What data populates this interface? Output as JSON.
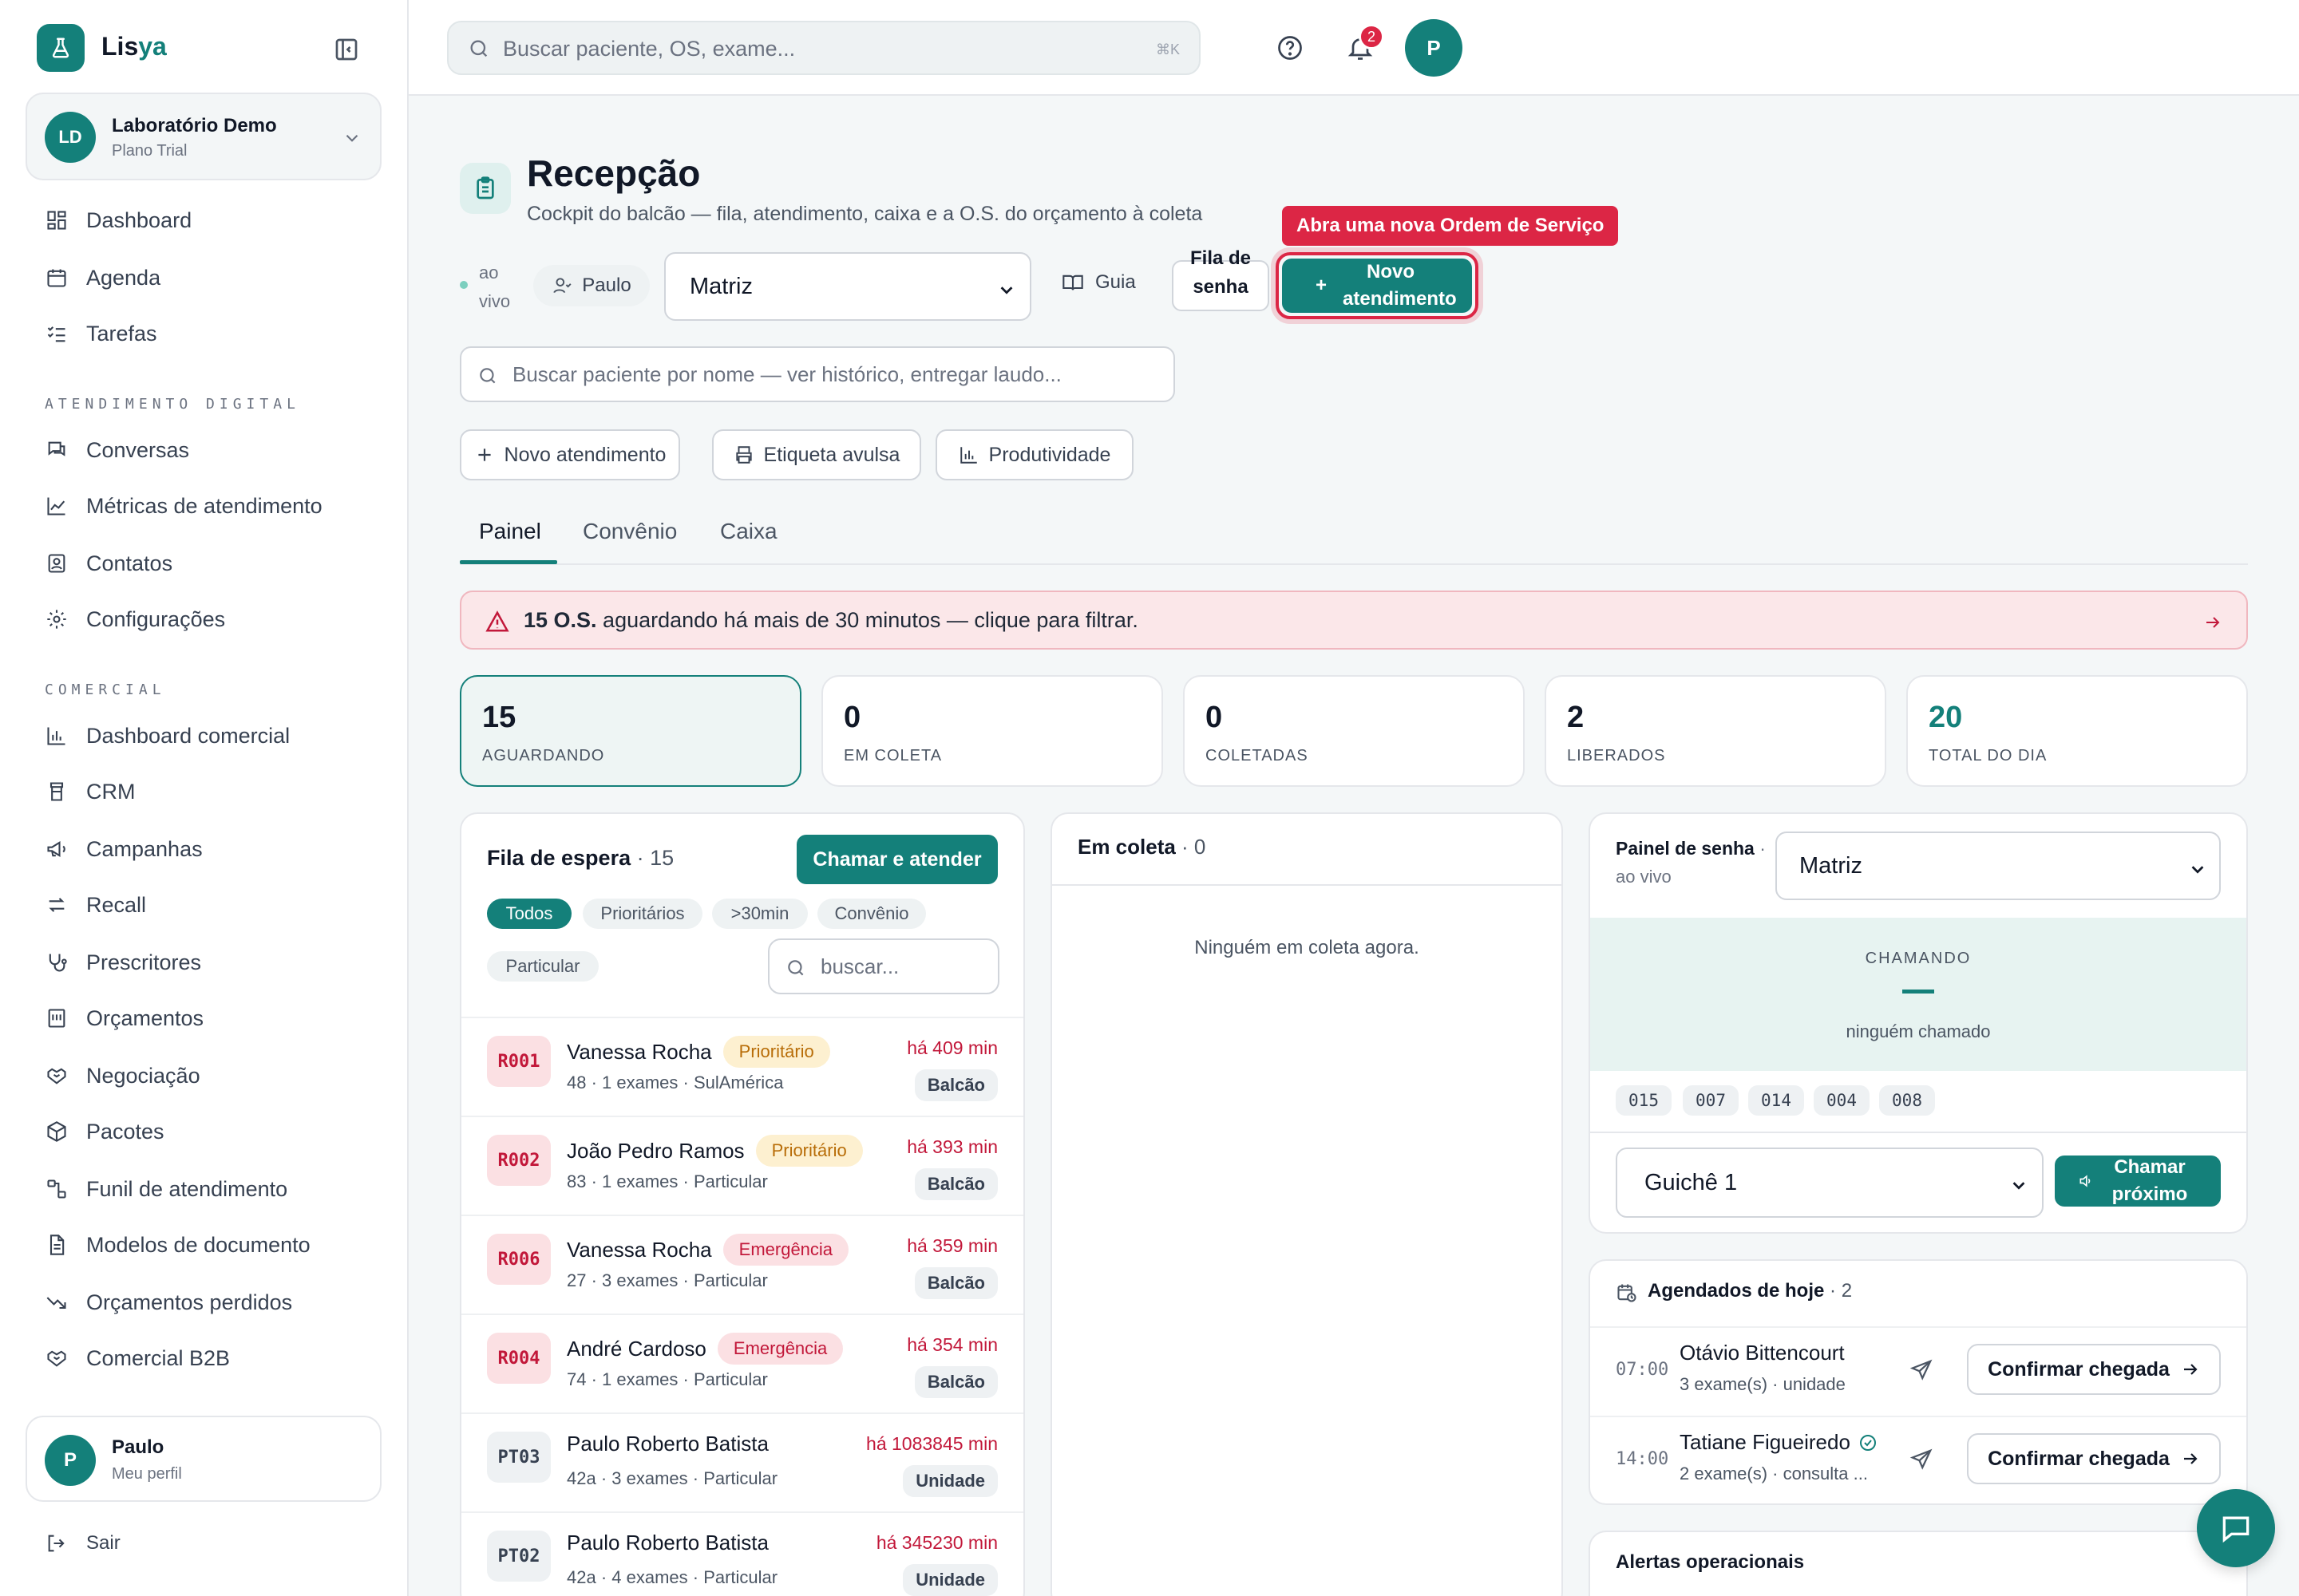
{
  "app": {
    "name_part1": "Lis",
    "name_part2": "ya"
  },
  "org": {
    "initials": "LD",
    "name": "Laboratório Demo",
    "plan": "Plano Trial"
  },
  "nav": {
    "main": [
      {
        "label": "Dashboard",
        "icon": "grid-icon"
      },
      {
        "label": "Agenda",
        "icon": "calendar-icon"
      },
      {
        "label": "Tarefas",
        "icon": "checklist-icon"
      }
    ],
    "section_digital": "ATENDIMENTO DIGITAL",
    "digital": [
      {
        "label": "Conversas",
        "icon": "chat-icon"
      },
      {
        "label": "Métricas de atendimento",
        "icon": "line-chart-icon"
      },
      {
        "label": "Contatos",
        "icon": "contact-icon"
      },
      {
        "label": "Configurações",
        "icon": "gear-icon"
      }
    ],
    "section_comercial": "COMERCIAL",
    "comercial": [
      {
        "label": "Dashboard comercial",
        "icon": "bar-chart-icon"
      },
      {
        "label": "CRM",
        "icon": "crm-icon"
      },
      {
        "label": "Campanhas",
        "icon": "megaphone-icon"
      },
      {
        "label": "Recall",
        "icon": "recall-icon"
      },
      {
        "label": "Prescritores",
        "icon": "stethoscope-icon"
      },
      {
        "label": "Orçamentos",
        "icon": "quote-icon"
      },
      {
        "label": "Negociação",
        "icon": "handshake-icon"
      },
      {
        "label": "Pacotes",
        "icon": "package-icon"
      },
      {
        "label": "Funil de atendimento",
        "icon": "funnel-icon"
      },
      {
        "label": "Modelos de documento",
        "icon": "document-icon"
      },
      {
        "label": "Orçamentos perdidos",
        "icon": "trend-down-icon"
      },
      {
        "label": "Comercial B2B",
        "icon": "handshake-icon"
      }
    ]
  },
  "profile": {
    "initial": "P",
    "name": "Paulo",
    "sub": "Meu perfil"
  },
  "logout_label": "Sair",
  "topbar": {
    "search_placeholder": "Buscar paciente, OS, exame...",
    "shortcut": "⌘K",
    "notifications": "2",
    "avatar_initial": "P"
  },
  "page": {
    "title": "Recepção",
    "subtitle": "Cockpit do balcão — fila, atendimento, caixa e a O.S. do orçamento à coleta",
    "tooltip": "Abra uma nova Ordem de Serviço",
    "live_label": "ao vivo",
    "user_chip": "Paulo",
    "unit_select": "Matriz",
    "guia_label": "Guia",
    "fila_senha_label": "Fila de senha",
    "novo_atendimento_label": "Novo atendimento",
    "patient_search_placeholder": "Buscar paciente por nome — ver histórico, entregar laudo...",
    "actions": [
      "Novo atendimento",
      "Etiqueta avulsa",
      "Produtividade"
    ],
    "tabs": [
      "Painel",
      "Convênio",
      "Caixa"
    ],
    "alert": {
      "bold": "15 O.S.",
      "text": " aguardando há mais de 30 minutos — clique para filtrar."
    },
    "stats": [
      {
        "value": "15",
        "label": "AGUARDANDO"
      },
      {
        "value": "0",
        "label": "EM COLETA"
      },
      {
        "value": "0",
        "label": "COLETADAS"
      },
      {
        "value": "2",
        "label": "LIBERADOS"
      },
      {
        "value": "20",
        "label": "TOTAL DO DIA"
      }
    ]
  },
  "fila": {
    "title": "Fila de espera",
    "count": " · 15",
    "call_button": "Chamar e atender",
    "filters": [
      "Todos",
      "Prioritários",
      ">30min",
      "Convênio",
      "Particular"
    ],
    "search_placeholder": "buscar...",
    "rows": [
      {
        "code": "R001",
        "name": "Vanessa Rocha",
        "badge": "Prioritário",
        "meta": "48 · 1 exames · SulAmérica",
        "wait": "há 409 min",
        "loc": "Balcão"
      },
      {
        "code": "R002",
        "name": "João Pedro Ramos",
        "badge": "Prioritário",
        "meta": "83 · 1 exames · Particular",
        "wait": "há 393 min",
        "loc": "Balcão"
      },
      {
        "code": "R006",
        "name": "Vanessa Rocha",
        "badge": "Emergência",
        "meta": "27 · 3 exames · Particular",
        "wait": "há 359 min",
        "loc": "Balcão"
      },
      {
        "code": "R004",
        "name": "André Cardoso",
        "badge": "Emergência",
        "meta": "74 · 1 exames · Particular",
        "wait": "há 354 min",
        "loc": "Balcão"
      },
      {
        "code": "PT03",
        "name": "Paulo Roberto Batista",
        "badge": "",
        "meta": "42a · 3 exames · Particular",
        "wait": "há 1083845 min",
        "loc": "Unidade"
      },
      {
        "code": "PT02",
        "name": "Paulo Roberto Batista",
        "badge": "",
        "meta": "42a · 4 exames · Particular",
        "wait": "há 345230 min",
        "loc": "Unidade"
      }
    ]
  },
  "coleta": {
    "title": "Em coleta",
    "count": " · 0",
    "empty": "Ninguém em coleta agora."
  },
  "senha": {
    "title": "Painel de senha",
    "dot": " ·",
    "sub": "ao vivo",
    "unit_select": "Matriz",
    "chamando": "CHAMANDO",
    "none": "ninguém chamado",
    "tickets": [
      "015",
      "007",
      "014",
      "004",
      "008"
    ],
    "guiche_select": "Guichê 1",
    "call_next": "Chamar próximo"
  },
  "agendados": {
    "title": "Agendados de hoje",
    "count": " · 2",
    "rows": [
      {
        "time": "07:00",
        "name": "Otávio Bittencourt",
        "meta": "3 exame(s) · unidade",
        "button": "Confirmar chegada"
      },
      {
        "time": "14:00",
        "name": "Tatiane Figueiredo",
        "meta": "2 exame(s) · consulta ...",
        "button": "Confirmar chegada"
      }
    ]
  },
  "alertas": {
    "title": "Alertas operacionais"
  },
  "colors": {
    "primary": "#14807a",
    "danger": "#dc2645",
    "warning_bg": "#fdf0d0",
    "alert_bg": "#fbe7e9"
  }
}
